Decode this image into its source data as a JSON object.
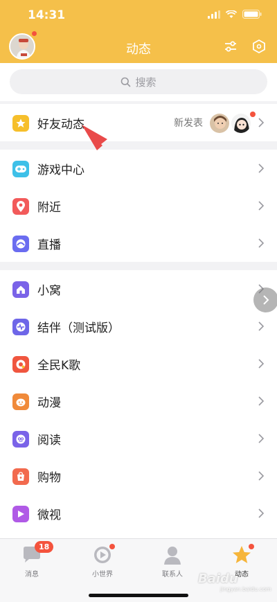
{
  "status_bar": {
    "time": "14:31"
  },
  "header": {
    "title": "动态"
  },
  "search": {
    "placeholder": "搜索"
  },
  "friend_feed": {
    "label": "好友动态",
    "subtext": "新发表"
  },
  "section_games": [
    {
      "label": "游戏中心",
      "icon": "gamepad-icon",
      "color": "#3ec0e8"
    },
    {
      "label": "附近",
      "icon": "location-pin-icon",
      "color": "#f25a5a"
    },
    {
      "label": "直播",
      "icon": "live-icon",
      "color": "#6a6cf0"
    }
  ],
  "section_apps": [
    {
      "label": "小窝",
      "icon": "home-icon",
      "color": "#7a63e8"
    },
    {
      "label": "结伴（测试版）",
      "icon": "pulse-icon",
      "color": "#6e66e8"
    },
    {
      "label": "全民K歌",
      "icon": "karaoke-icon",
      "color": "#f0563f"
    },
    {
      "label": "动漫",
      "icon": "anime-icon",
      "color": "#f08a3a"
    },
    {
      "label": "阅读",
      "icon": "reading-icon",
      "color": "#7a63e8"
    },
    {
      "label": "购物",
      "icon": "shopping-icon",
      "color": "#f26a4e"
    },
    {
      "label": "微视",
      "icon": "weishi-icon",
      "color": "#b05ae6"
    }
  ],
  "tabbar": {
    "tabs": [
      {
        "label": "消息",
        "icon": "message-icon",
        "badge": "18"
      },
      {
        "label": "小世界",
        "icon": "play-circle-icon"
      },
      {
        "label": "联系人",
        "icon": "contacts-icon"
      },
      {
        "label": "动态",
        "icon": "star-icon"
      }
    ]
  },
  "watermark": {
    "text": "Baidu",
    "sub": "jingyan.baidu.com"
  },
  "colors": {
    "header": "#f5c04a",
    "accent_red": "#f4533d",
    "arrow": "#e94a4a"
  }
}
